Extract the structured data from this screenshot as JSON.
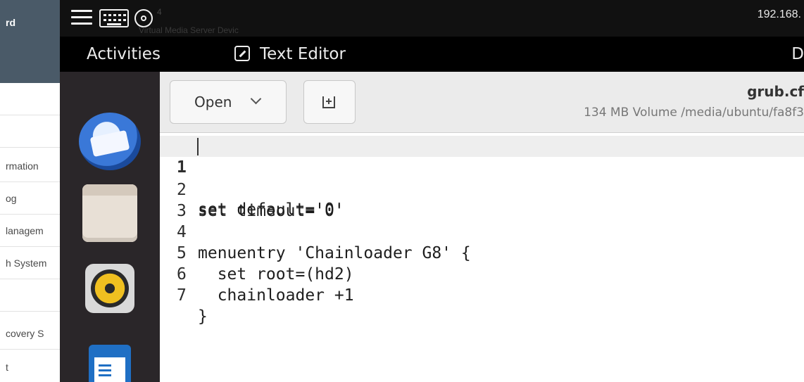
{
  "web_sidebar": {
    "brand": "rd",
    "items": [
      "",
      "rmation",
      "og",
      "lanagem",
      "h System",
      "",
      "covery S",
      "t"
    ]
  },
  "console": {
    "tab_number": "4",
    "ghost_text": "Virtual Media Server Devic",
    "ip": "192.168."
  },
  "gnome": {
    "activities": "Activities",
    "app_name": "Text Editor",
    "right_fragment": "D"
  },
  "dock": [
    "thunderbird-icon",
    "files-icon",
    "rhythmbox-icon",
    "writer-icon"
  ],
  "editor": {
    "open_label": "Open",
    "title": "grub.cf",
    "subtitle": "134 MB Volume /media/ubuntu/fa8f3",
    "lines": [
      {
        "n": "1",
        "text": "set default='0'"
      },
      {
        "n": "2",
        "text": "set timeout='0'"
      },
      {
        "n": "3",
        "text": ""
      },
      {
        "n": "4",
        "text": "menuentry 'Chainloader G8' {"
      },
      {
        "n": "5",
        "text": "  set root=(hd2)"
      },
      {
        "n": "6",
        "text": "  chainloader +1"
      },
      {
        "n": "7",
        "text": "}"
      }
    ]
  },
  "colors": {
    "panel": "#000000",
    "dock": "#2a2629",
    "headerbar": "#ebebeb",
    "current_line": "#eeeeee",
    "web_brand": "#4a5a68"
  }
}
